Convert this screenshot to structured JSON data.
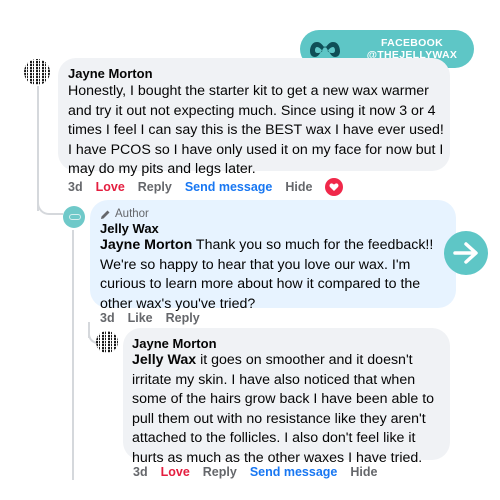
{
  "badge": {
    "line1": "FACEBOOK",
    "line2": "@THEJELLYWAX",
    "color": "#5ec6c6"
  },
  "comment1": {
    "author": "Jayne Morton",
    "text": "Honestly, I bought the starter kit to get a new wax warmer and try it out not expecting much. Since using it now 3 or 4 times I feel I can say this is the BEST wax I have ever used! I have PCOS so I have only used it on my face for now but I may do my pits and legs later.",
    "actions": {
      "time": "3d",
      "love": "Love",
      "reply": "Reply",
      "send": "Send message",
      "hide": "Hide"
    },
    "reaction": "heart-icon"
  },
  "comment2": {
    "tag": "Author",
    "author": "Jelly Wax",
    "mention": "Jayne Morton",
    "text": " Thank you so much for the feedback!! We're so happy to hear that you love our wax. I'm curious to learn more about how it compared to the other wax's you've tried?",
    "actions": {
      "time": "3d",
      "like": "Like",
      "reply": "Reply"
    }
  },
  "comment3": {
    "author": "Jayne Morton",
    "mention": "Jelly Wax",
    "text": " it goes on smoother and it doesn't irritate my skin. I have also noticed that when some of the hairs grow back I have been able to pull them out with no resistance like they aren't attached to the follicles. I also don't feel like it hurts as much as the other waxes I have tried.",
    "actions": {
      "time": "3d",
      "love": "Love",
      "reply": "Reply",
      "send": "Send message",
      "hide": "Hide"
    }
  },
  "colors": {
    "accent": "#5ec6c6",
    "love": "#e41e3f",
    "link": "#1877f2",
    "bubble": "#f0f2f5",
    "author_bubble": "#e7f3ff"
  }
}
